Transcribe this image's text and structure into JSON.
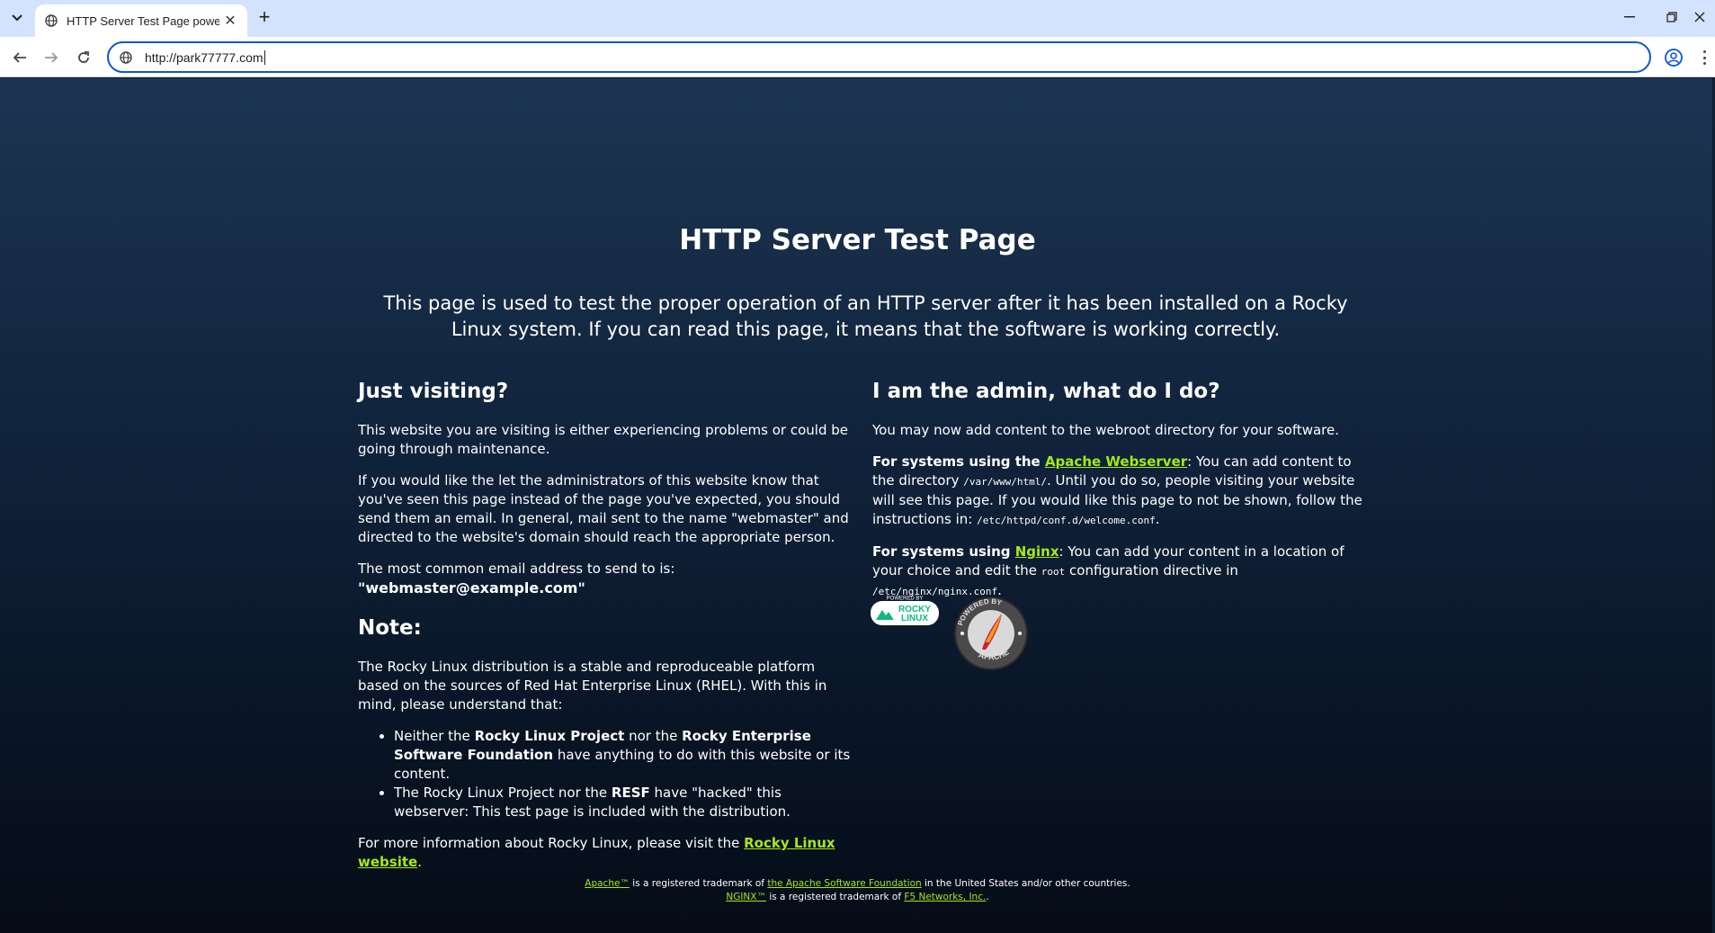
{
  "browser": {
    "tab_title": "HTTP Server Test Page powered by",
    "url": "http://park77777.com"
  },
  "page": {
    "title": "HTTP Server Test Page",
    "subtitle": "This page is used to test the proper operation of an HTTP server after it has been installed on a Rocky Linux system. If you can read this page, it means that the software is working correctly.",
    "visiting": {
      "heading": "Just visiting?",
      "p1": "This website you are visiting is either experiencing problems or could be going through maintenance.",
      "p2": "If you would like the let the administrators of this website know that you've seen this page instead of the page you've expected, you should send them an email. In general, mail sent to the name \"webmaster\" and directed to the website's domain should reach the appropriate person.",
      "p3_pre": "The most common email address to send to is: ",
      "p3_email": "\"webmaster@example.com\""
    },
    "note": {
      "heading": "Note:",
      "p1": "The Rocky Linux distribution is a stable and reproduceable platform based on the sources of Red Hat Enterprise Linux (RHEL). With this in mind, please understand that:",
      "li1_a": "Neither the ",
      "li1_b": "Rocky Linux Project",
      "li1_c": " nor the ",
      "li1_d": "Rocky Enterprise Software Foundation",
      "li1_e": " have anything to do with this website or its content.",
      "li2_a": "The Rocky Linux Project nor the ",
      "li2_b": "RESF",
      "li2_c": " have \"hacked\" this webserver: This test page is included with the distribution.",
      "more_pre": "For more information about Rocky Linux, please visit the ",
      "more_link": "Rocky Linux website",
      "more_post": "."
    },
    "admin": {
      "heading": "I am the admin, what do I do?",
      "p1": "You may now add content to the webroot directory for your software.",
      "apache_pre": "For systems using the ",
      "apache_link": "Apache Webserver",
      "apache_t1": ": You can add content to the directory ",
      "apache_code1": "/var/www/html/",
      "apache_t2": ". Until you do so, people visiting your website will see this page. If you would like this page to not be shown, follow the instructions in: ",
      "apache_code2": "/etc/httpd/conf.d/welcome.conf",
      "apache_t3": ".",
      "nginx_pre": "For systems using ",
      "nginx_link": "Nginx",
      "nginx_t1": ": You can add your content in a location of your choice and edit the ",
      "nginx_code1": "root",
      "nginx_t2": " configuration directive in ",
      "nginx_code2": "/etc/nginx/nginx.conf",
      "nginx_t3": "."
    },
    "badges": {
      "rocky_top": "POWERED BY",
      "rocky_line1": "ROCKY",
      "rocky_line2": "LINUX",
      "apache_top": "POWERED BY",
      "apache_bottom": "APACHE"
    },
    "footer": {
      "l1_link1": "Apache™",
      "l1_t1": " is a registered trademark of ",
      "l1_link2": "the Apache Software Foundation",
      "l1_t2": " in the United States and/or other countries.",
      "l2_link1": "NGINX™",
      "l2_t1": " is a registered trademark of ",
      "l2_link2": "F5 Networks, Inc.",
      "l2_t2": "."
    }
  },
  "colors": {
    "link": "#a6e81b",
    "bg_top": "#1c3552",
    "bg_bottom": "#050c17",
    "omnibox_border": "#0b57d0"
  },
  "icons": [
    "tab-list-icon",
    "globe-icon",
    "close-icon",
    "plus-icon",
    "minimize-icon",
    "restore-icon",
    "back-icon",
    "forward-icon",
    "reload-icon",
    "site-info-icon",
    "profile-icon",
    "menu-icon"
  ]
}
